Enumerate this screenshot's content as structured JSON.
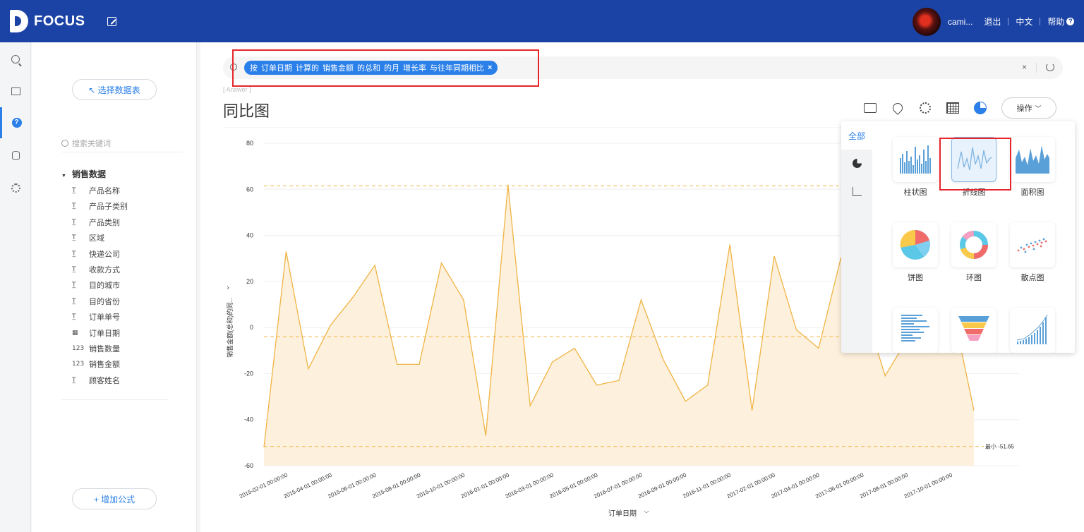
{
  "header": {
    "brand": "FOCUS",
    "user_name": "cami...",
    "logout": "退出",
    "language": "中文",
    "help": "帮助"
  },
  "sidebar": {
    "select_table_button": "↖ 选择数据表",
    "search_placeholder": "搜索关键词",
    "dataset_name": "销售数据",
    "fields": [
      {
        "label": "产品名称",
        "type": "text"
      },
      {
        "label": "产品子类别",
        "type": "text"
      },
      {
        "label": "产品类别",
        "type": "text"
      },
      {
        "label": "区域",
        "type": "text"
      },
      {
        "label": "快递公司",
        "type": "text"
      },
      {
        "label": "收款方式",
        "type": "text"
      },
      {
        "label": "目的城市",
        "type": "text"
      },
      {
        "label": "目的省份",
        "type": "text"
      },
      {
        "label": "订单单号",
        "type": "text"
      },
      {
        "label": "订单日期",
        "type": "date"
      },
      {
        "label": "销售数量",
        "type": "number"
      },
      {
        "label": "销售金额",
        "type": "number"
      },
      {
        "label": "顾客姓名",
        "type": "text"
      }
    ],
    "add_formula_button": "+ 增加公式"
  },
  "query": {
    "tokens": [
      "按",
      "订单日期",
      "计算的",
      "销售金额",
      "的总和",
      "的月",
      "增长率",
      "与往年同期相比"
    ],
    "clear": "×"
  },
  "answer": {
    "tag": "[ Answer ]",
    "title": "同比图",
    "ops_button": "操作"
  },
  "chart_panel": {
    "all_tab": "全部",
    "types": [
      "柱状图",
      "折线图",
      "面积图",
      "饼图",
      "环图",
      "散点图"
    ]
  },
  "chart_data": {
    "type": "area",
    "xlabel": "订单日期",
    "ylabel": "销售金额(总和)的同...",
    "ylim": [
      -60,
      80
    ],
    "yticks": [
      80,
      60,
      40,
      20,
      0,
      -20,
      -40,
      -60
    ],
    "xtick_labels": [
      "2015-02-01 00:00:00",
      "2015-04-01 00:00:00",
      "2015-06-01 00:00:00",
      "2015-08-01 00:00:00",
      "2015-10-01 00:00:00",
      "2016-01-01 00:00:00",
      "2016-03-01 00:00:00",
      "2016-05-01 00:00:00",
      "2016-07-01 00:00:00",
      "2016-09-01 00:00:00",
      "2016-11-01 00:00:00",
      "2017-02-01 00:00:00",
      "2017-04-01 00:00:00",
      "2017-06-01 00:00:00",
      "2017-08-01 00:00:00",
      "2017-10-01 00:00:00"
    ],
    "values": [
      -52,
      33,
      -18,
      1,
      13,
      27,
      -16,
      -16,
      28,
      12,
      -47,
      62,
      -34,
      -15,
      -9,
      -25,
      -23,
      12,
      -14,
      -32,
      -25,
      36,
      -36,
      31,
      -1,
      -9,
      30,
      10,
      -21,
      -5,
      3,
      10,
      -36
    ],
    "min_label": "最小 -51.65",
    "reference_lines": [
      61.5,
      -4,
      -51.65
    ],
    "series_color": "#f0b445",
    "fill_color": "#fdf0dc"
  }
}
